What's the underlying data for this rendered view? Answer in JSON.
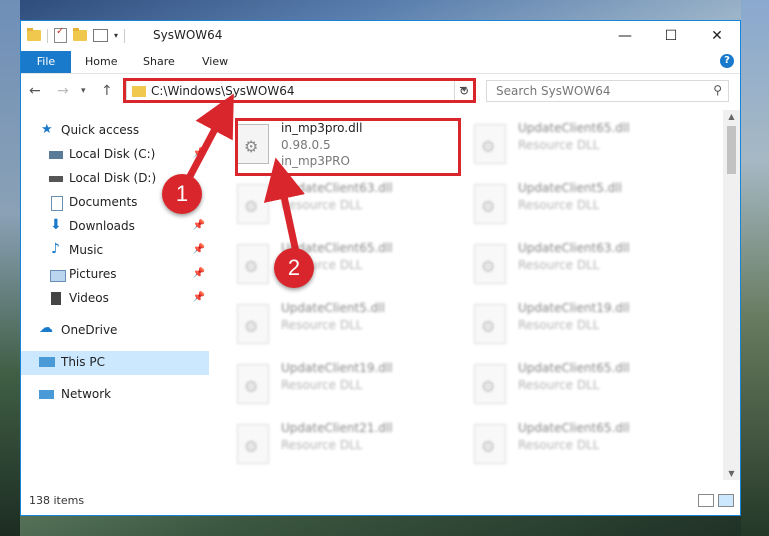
{
  "window": {
    "title": "SysWOW64"
  },
  "ribbon": {
    "tabs": [
      "File",
      "Home",
      "Share",
      "View"
    ],
    "help": "?"
  },
  "nav": {
    "address": "C:\\Windows\\SysWOW64",
    "search_placeholder": "Search SysWOW64"
  },
  "sidebar": {
    "items": [
      {
        "label": "Quick access",
        "icon": "star-icon"
      },
      {
        "label": "Local Disk (C:)",
        "icon": "drive-icon"
      },
      {
        "label": "Local Disk (D:)",
        "icon": "drive-icon"
      },
      {
        "label": "Documents",
        "icon": "documents-icon"
      },
      {
        "label": "Downloads",
        "icon": "download-icon"
      },
      {
        "label": "Music",
        "icon": "music-icon"
      },
      {
        "label": "Pictures",
        "icon": "pictures-icon"
      },
      {
        "label": "Videos",
        "icon": "videos-icon"
      },
      {
        "label": "OneDrive",
        "icon": "cloud-icon"
      },
      {
        "label": "This PC",
        "icon": "computer-icon"
      },
      {
        "label": "Network",
        "icon": "network-icon"
      }
    ]
  },
  "files": [
    {
      "name": "in_mp3pro.dll",
      "line2": "0.98.0.5",
      "line3": "in_mp3PRO"
    },
    {
      "name": "UpdateClient65.dll",
      "line2": "Resource DLL",
      "line3": ""
    },
    {
      "name": "UpdateClient63.dll",
      "line2": "Resource DLL",
      "line3": ""
    },
    {
      "name": "UpdateClient5.dll",
      "line2": "Resource DLL",
      "line3": ""
    },
    {
      "name": "UpdateClient65.dll",
      "line2": "Resource DLL",
      "line3": ""
    },
    {
      "name": "UpdateClient63.dll",
      "line2": "Resource DLL",
      "line3": ""
    },
    {
      "name": "UpdateClient5.dll",
      "line2": "Resource DLL",
      "line3": ""
    },
    {
      "name": "UpdateClient19.dll",
      "line2": "Resource DLL",
      "line3": ""
    },
    {
      "name": "UpdateClient19.dll",
      "line2": "Resource DLL",
      "line3": ""
    },
    {
      "name": "UpdateClient65.dll",
      "line2": "Resource DLL",
      "line3": ""
    },
    {
      "name": "UpdateClient21.dll",
      "line2": "Resource DLL",
      "line3": ""
    },
    {
      "name": "UpdateClient65.dll",
      "line2": "Resource DLL",
      "line3": ""
    }
  ],
  "status": {
    "item_count": "138 items"
  },
  "annotations": {
    "step1": "1",
    "step2": "2"
  }
}
